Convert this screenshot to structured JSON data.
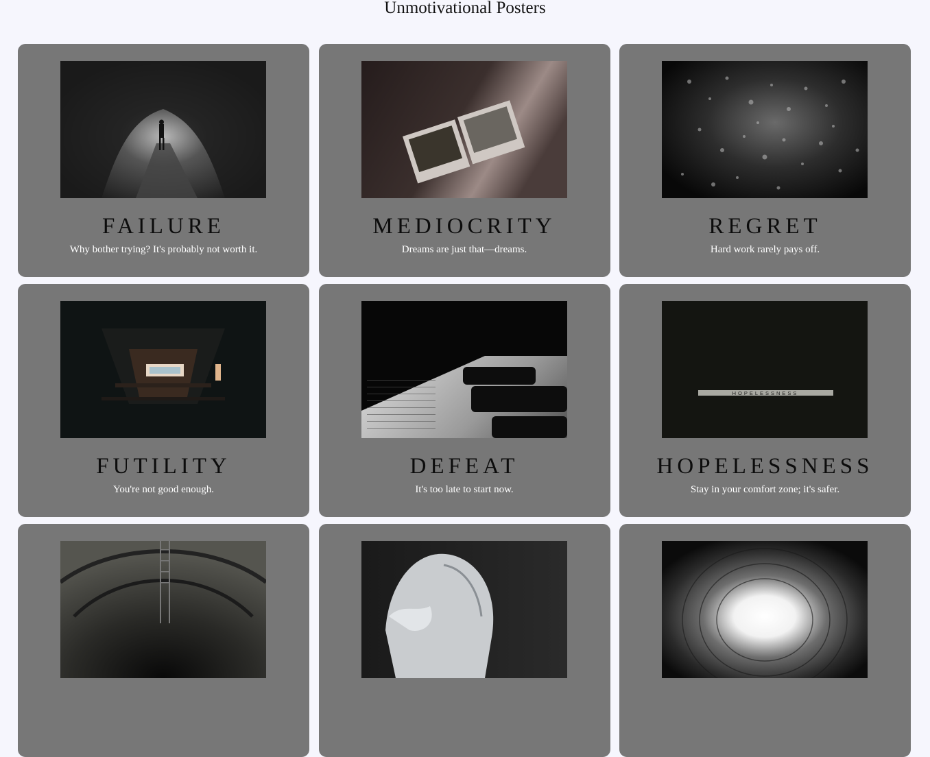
{
  "page": {
    "title": "Unmotivational Posters"
  },
  "posters": [
    {
      "title": "FAILURE",
      "tagline": "Why bother trying? It's probably not worth it.",
      "image": "forest-path-figure-image"
    },
    {
      "title": "MEDIOCRITY",
      "tagline": "Dreams are just that—dreams.",
      "image": "polaroids-image"
    },
    {
      "title": "REGRET",
      "tagline": "Hard work rarely pays off.",
      "image": "raindrops-window-image"
    },
    {
      "title": "FUTILITY",
      "tagline": "You're not good enough.",
      "image": "dark-tunnel-image"
    },
    {
      "title": "DEFEAT",
      "tagline": "It's too late to start now.",
      "image": "laptop-keyboard-image"
    },
    {
      "title": "HOPELESSNESS",
      "tagline": "Stay in your comfort zone; it's safer.",
      "image": "hopelessness-tiles-image",
      "image_text": "HOPELESSNESS"
    },
    {
      "title": "",
      "tagline": "",
      "image": "tunnel-ladder-image"
    },
    {
      "title": "",
      "tagline": "",
      "image": "crumpled-cup-image"
    },
    {
      "title": "",
      "tagline": "",
      "image": "light-well-image"
    }
  ]
}
